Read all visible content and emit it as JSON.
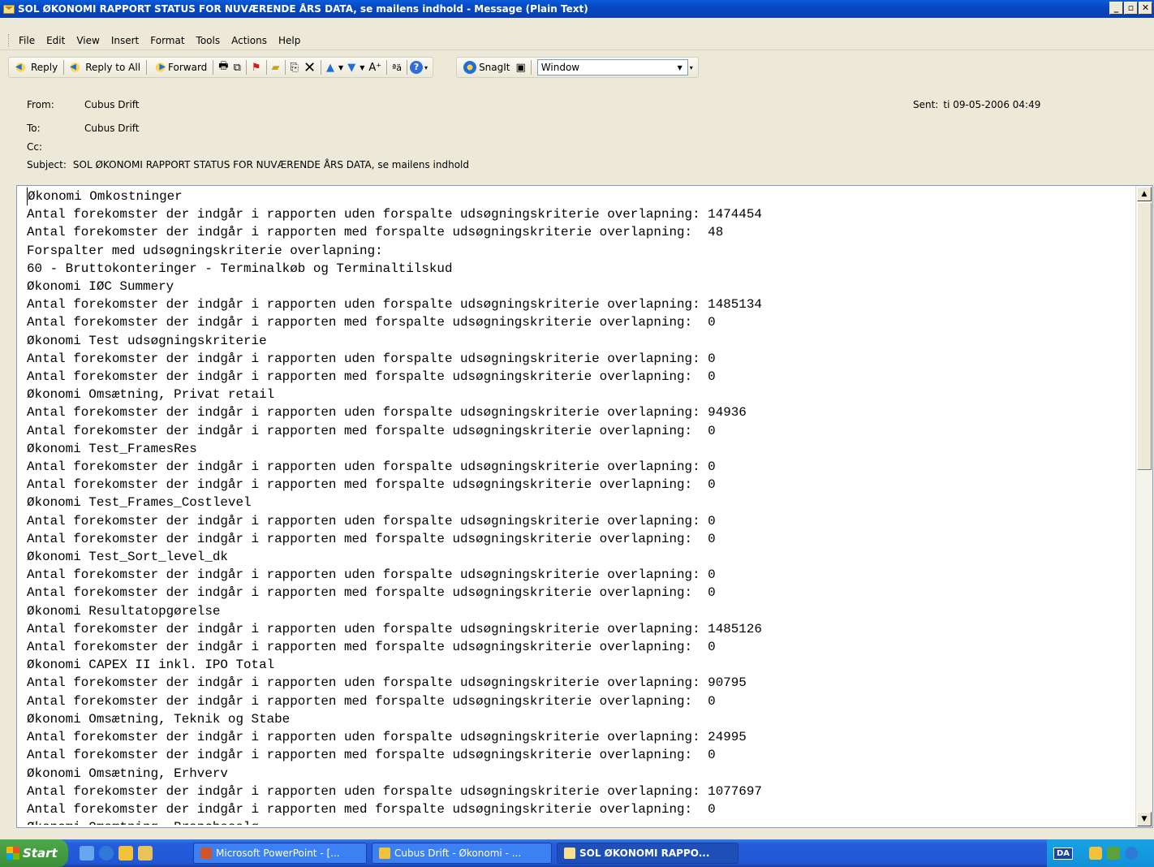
{
  "window": {
    "title": "SOL ØKONOMI RAPPORT STATUS FOR NUVÆRENDE ÅRS DATA, se mailens indhold - Message (Plain Text)"
  },
  "menu": [
    "File",
    "Edit",
    "View",
    "Insert",
    "Format",
    "Tools",
    "Actions",
    "Help"
  ],
  "toolbar": {
    "reply": "Reply",
    "reply_all": "Reply to All",
    "forward": "Forward",
    "snagit": "SnagIt",
    "window_combo": "Window"
  },
  "header": {
    "from_label": "From:",
    "from": "Cubus Drift",
    "to_label": "To:",
    "to": "Cubus Drift",
    "cc_label": "Cc:",
    "cc": "",
    "subject_label": "Subject:",
    "subject": "SOL ØKONOMI RAPPORT STATUS FOR NUVÆRENDE ÅRS DATA, se mailens indhold",
    "sent_label": "Sent:",
    "sent": "ti 09-05-2006 04:49"
  },
  "body_lines": [
    "Økonomi Omkostninger",
    "Antal forekomster der indgår i rapporten uden forspalte udsøgningskriterie overlapning: 1474454",
    "Antal forekomster der indgår i rapporten med forspalte udsøgningskriterie overlapning:  48",
    "Forspalter med udsøgningskriterie overlapning:",
    "60 - Bruttokonteringer - Terminalkøb og Terminaltilskud",
    "Økonomi IØC Summery",
    "Antal forekomster der indgår i rapporten uden forspalte udsøgningskriterie overlapning: 1485134",
    "Antal forekomster der indgår i rapporten med forspalte udsøgningskriterie overlapning:  0",
    "Økonomi Test udsøgningskriterie",
    "Antal forekomster der indgår i rapporten uden forspalte udsøgningskriterie overlapning: 0",
    "Antal forekomster der indgår i rapporten med forspalte udsøgningskriterie overlapning:  0",
    "Økonomi Omsætning, Privat retail",
    "Antal forekomster der indgår i rapporten uden forspalte udsøgningskriterie overlapning: 94936",
    "Antal forekomster der indgår i rapporten med forspalte udsøgningskriterie overlapning:  0",
    "Økonomi Test_FramesRes",
    "Antal forekomster der indgår i rapporten uden forspalte udsøgningskriterie overlapning: 0",
    "Antal forekomster der indgår i rapporten med forspalte udsøgningskriterie overlapning:  0",
    "Økonomi Test_Frames_Costlevel",
    "Antal forekomster der indgår i rapporten uden forspalte udsøgningskriterie overlapning: 0",
    "Antal forekomster der indgår i rapporten med forspalte udsøgningskriterie overlapning:  0",
    "Økonomi Test_Sort_level_dk",
    "Antal forekomster der indgår i rapporten uden forspalte udsøgningskriterie overlapning: 0",
    "Antal forekomster der indgår i rapporten med forspalte udsøgningskriterie overlapning:  0",
    "Økonomi Resultatopgørelse",
    "Antal forekomster der indgår i rapporten uden forspalte udsøgningskriterie overlapning: 1485126",
    "Antal forekomster der indgår i rapporten med forspalte udsøgningskriterie overlapning:  0",
    "Økonomi CAPEX II inkl. IPO Total",
    "Antal forekomster der indgår i rapporten uden forspalte udsøgningskriterie overlapning: 90795",
    "Antal forekomster der indgår i rapporten med forspalte udsøgningskriterie overlapning:  0",
    "Økonomi Omsætning, Teknik og Stabe",
    "Antal forekomster der indgår i rapporten uden forspalte udsøgningskriterie overlapning: 24995",
    "Antal forekomster der indgår i rapporten med forspalte udsøgningskriterie overlapning:  0",
    "Økonomi Omsætning, Erhverv",
    "Antal forekomster der indgår i rapporten uden forspalte udsøgningskriterie overlapning: 1077697",
    "Antal forekomster der indgår i rapporten med forspalte udsøgningskriterie overlapning:  0",
    "Økonomi Omsætning, Branchesalg"
  ],
  "taskbar": {
    "start": "Start",
    "tasks": [
      "Microsoft PowerPoint - [...",
      "Cubus Drift - Økonomi - ...",
      "SOL ØKONOMI RAPPO..."
    ],
    "tray_lang": "DA"
  }
}
